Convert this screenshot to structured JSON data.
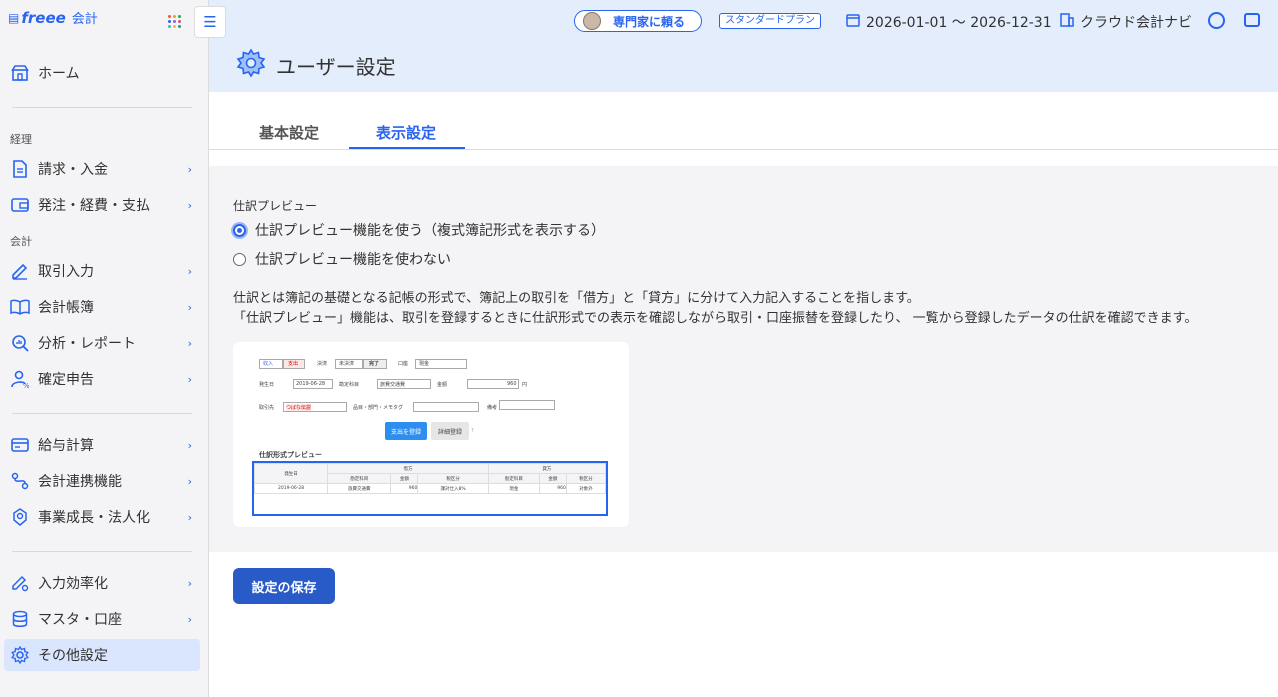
{
  "app": {
    "logo": "freee",
    "logo_sub": "会計"
  },
  "sidebar": {
    "home": "ホーム",
    "section_keiri": "経理",
    "section_kaikei": "会計",
    "items": [
      {
        "label": "請求・入金",
        "icon": "document-icon"
      },
      {
        "label": "発注・経費・支払",
        "icon": "wallet-icon"
      },
      {
        "label": "取引入力",
        "icon": "pen-icon"
      },
      {
        "label": "会計帳簿",
        "icon": "book-icon"
      },
      {
        "label": "分析・レポート",
        "icon": "analysis-icon"
      },
      {
        "label": "確定申告",
        "icon": "person-tax-icon"
      },
      {
        "label": "給与計算",
        "icon": "card-icon"
      },
      {
        "label": "会計連携機能",
        "icon": "link-icon"
      },
      {
        "label": "事業成長・法人化",
        "icon": "growth-icon"
      },
      {
        "label": "入力効率化",
        "icon": "efficiency-icon"
      },
      {
        "label": "マスタ・口座",
        "icon": "database-icon"
      },
      {
        "label": "その他設定",
        "icon": "gear-icon"
      }
    ]
  },
  "header": {
    "expert_button": "専門家に頼る",
    "plan_badge": "スタンダードプラン",
    "period": "2026-01-01 〜 2026-12-31",
    "navi": "クラウド会計ナビ"
  },
  "page": {
    "title": "ユーザー設定",
    "tabs": [
      "基本設定",
      "表示設定"
    ],
    "active_tab": "表示設定"
  },
  "settings": {
    "group_label": "仕訳プレビュー",
    "option_use": "仕訳プレビュー機能を使う（複式簿記形式を表示する）",
    "option_not_use": "仕訳プレビュー機能を使わない",
    "selected": "option_use",
    "desc_line1": "仕訳とは簿記の基礎となる記帳の形式で、簿記上の取引を「借方」と「貸方」に分けて入力記入することを指します。",
    "desc_line2": "「仕訳プレビュー」機能は、取引を登録するときに仕訳形式での表示を確認しながら取引・口座振替を登録したり、 一覧から登録したデータの仕訳を確認できます。"
  },
  "preview_image": {
    "tab_income": "収入",
    "tab_expense": "支出",
    "settle_label": "決済",
    "unsettled": "未決済",
    "settled": "完了",
    "account_label": "口座",
    "account_value": "現金",
    "date_label": "発生日",
    "date_value": "2019-06-28",
    "subject_label": "勘定科目",
    "subject_value": "旅費交通費",
    "amount_label": "金額",
    "amount_value": "960",
    "yen": "円",
    "partner_label": "取引先",
    "partner_tag": "つばな伝説",
    "item_label": "品目・部門・メモタグ",
    "note_label": "備考",
    "register_btn": "支出を登録",
    "detail_btn": "詳細登録",
    "section_title": "仕訳形式プレビュー",
    "th_date": "発生日",
    "th_debit": "借方",
    "th_credit": "貸方",
    "th_subject": "勘定科目",
    "th_amount": "金額",
    "th_tax": "税区分",
    "row": [
      "2019-06-28",
      "旅費交通費",
      "960",
      "課対仕入8%",
      "現金",
      "960",
      "対象外"
    ]
  },
  "save_button": "設定の保存"
}
